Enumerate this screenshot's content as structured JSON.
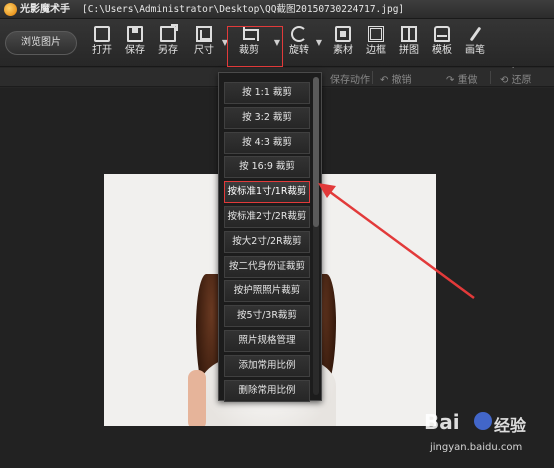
{
  "window": {
    "app_name": "光影魔术手",
    "file_path": "[C:\\Users\\Administrator\\Desktop\\QQ截图20150730224717.jpg]"
  },
  "toolbar": {
    "browse_label": "浏览图片",
    "tools": [
      {
        "id": "open",
        "label": "打开",
        "icon": "folder-open-icon"
      },
      {
        "id": "save",
        "label": "保存",
        "icon": "save-icon"
      },
      {
        "id": "saveas",
        "label": "另存",
        "icon": "save-as-icon"
      },
      {
        "id": "size",
        "label": "尺寸",
        "icon": "resize-icon"
      },
      {
        "id": "crop",
        "label": "裁剪",
        "icon": "crop-icon"
      },
      {
        "id": "rotate",
        "label": "旋转",
        "icon": "rotate-icon"
      },
      {
        "id": "material",
        "label": "素材",
        "icon": "material-icon"
      },
      {
        "id": "frame",
        "label": "边框",
        "icon": "frame-icon"
      },
      {
        "id": "collage",
        "label": "拼图",
        "icon": "collage-icon"
      },
      {
        "id": "template",
        "label": "模板",
        "icon": "template-icon"
      },
      {
        "id": "brush",
        "label": "画笔",
        "icon": "brush-icon"
      }
    ]
  },
  "subbar": {
    "save_action": "保存动作",
    "undo": "撤销",
    "redo": "重做",
    "restore": "还原"
  },
  "crop_menu": {
    "items": [
      "按 1:1 裁剪",
      "按 3:2 裁剪",
      "按 4:3 裁剪",
      "按 16:9 裁剪",
      "按标准1寸/1R裁剪",
      "按标准2寸/2R裁剪",
      "按大2寸/2R裁剪",
      "按二代身份证裁剪",
      "按护照照片裁剪",
      "按5寸/3R裁剪",
      "照片规格管理",
      "添加常用比例",
      "删除常用比例"
    ],
    "selected_index": 4
  },
  "watermark": {
    "brand": "Bai",
    "jingyan": "经验",
    "url": "jingyan.baidu.com"
  },
  "colors": {
    "highlight_red": "#e23a3a",
    "background": "#262626"
  }
}
